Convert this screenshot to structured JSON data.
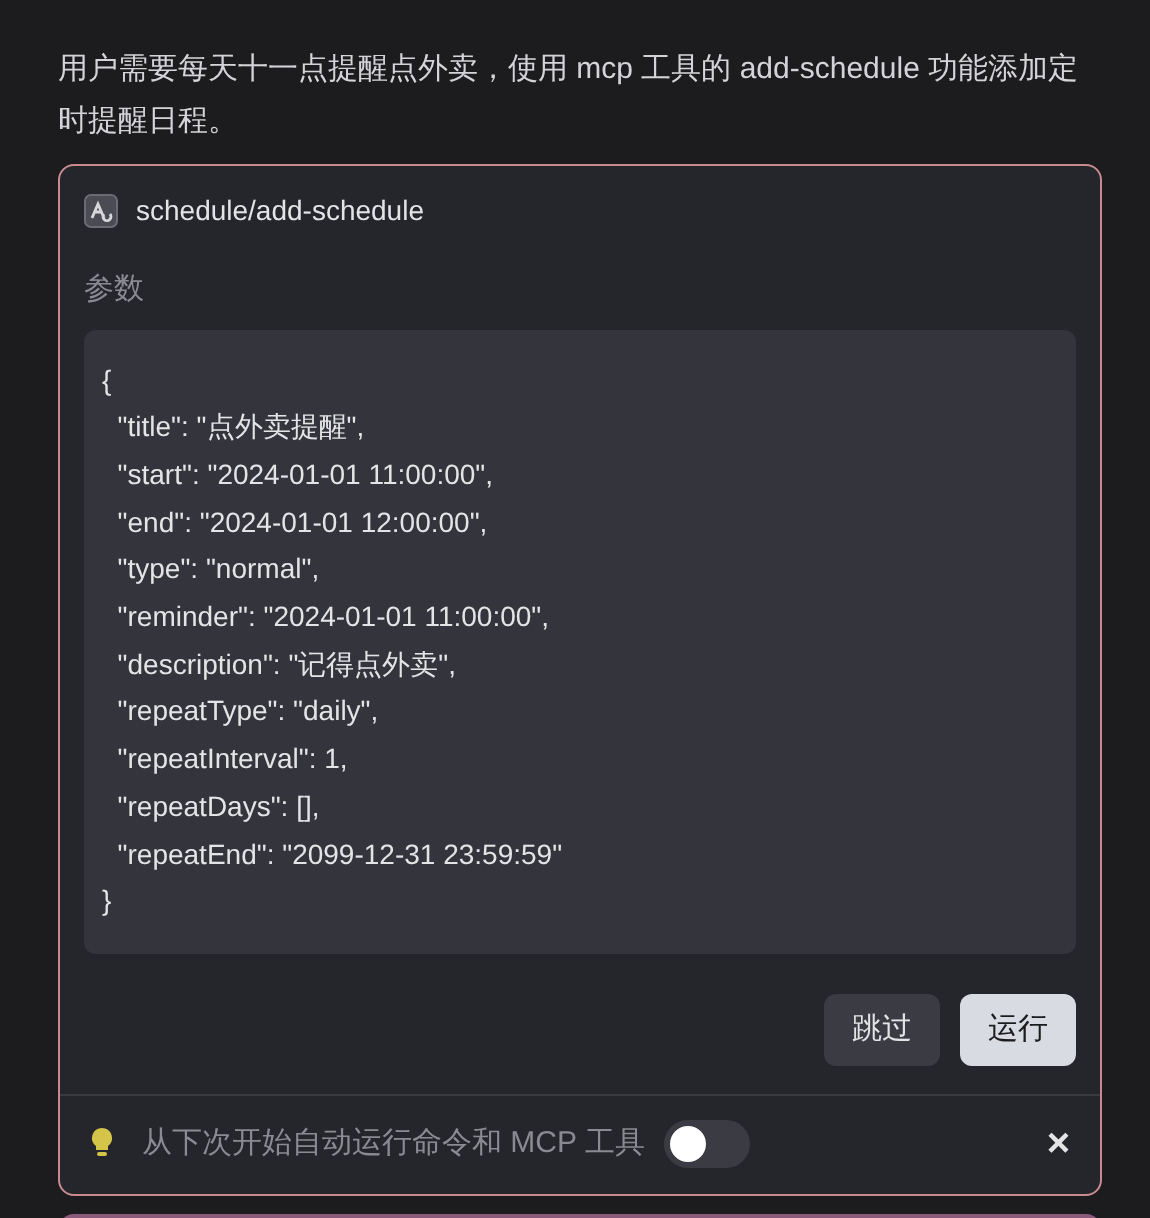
{
  "message": "用户需要每天十一点提醒点外卖，使用 mcp 工具的 add-schedule 功能添加定时提醒日程。",
  "tool_call": {
    "name": "schedule/add-schedule",
    "params_label": "参数",
    "code_lines": [
      "{",
      "  \"title\": \"点外卖提醒\",",
      "  \"start\": \"2024-01-01 11:00:00\",",
      "  \"end\": \"2024-01-01 12:00:00\",",
      "  \"type\": \"normal\",",
      "  \"reminder\": \"2024-01-01 11:00:00\",",
      "  \"description\": \"记得点外卖\",",
      "  \"repeatType\": \"daily\",",
      "  \"repeatInterval\": 1,",
      "  \"repeatDays\": [],",
      "  \"repeatEnd\": \"2099-12-31 23:59:59\"",
      "}"
    ],
    "buttons": [
      {
        "label": "跳过",
        "kind": "secondary"
      },
      {
        "label": "运行",
        "kind": "primary"
      }
    ],
    "auto_run": {
      "label": "从下次开始自动运行命令和 MCP 工具",
      "on": false,
      "close": "×"
    }
  }
}
